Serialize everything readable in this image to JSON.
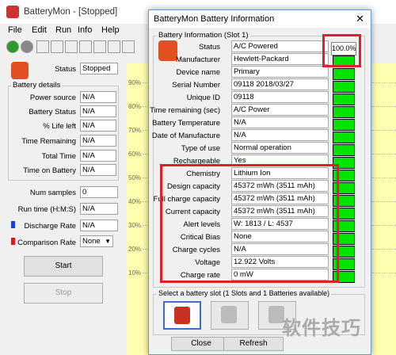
{
  "main": {
    "title": "BatteryMon - [Stopped]",
    "menu": [
      "File",
      "Edit",
      "Run",
      "Info",
      "Help"
    ],
    "status_label": "Status",
    "status_value": "Stopped",
    "details_title": "Battery details",
    "rows": [
      {
        "label": "Power source",
        "value": "N/A"
      },
      {
        "label": "Battery Status",
        "value": "N/A"
      },
      {
        "label": "% Life left",
        "value": "N/A"
      },
      {
        "label": "Time Remaining",
        "value": "N/A"
      },
      {
        "label": "Total Time",
        "value": "N/A"
      },
      {
        "label": "Time on Battery",
        "value": "N/A"
      }
    ],
    "num_samples_label": "Num samples",
    "num_samples": "0",
    "run_time_label": "Run time (H:M:S)",
    "run_time": "N/A",
    "discharge_label": "Discharge Rate",
    "discharge": "N/A",
    "comparison_label": "Comparison Rate",
    "comparison": "None",
    "start": "Start",
    "stop": "Stop",
    "graph_labels": [
      "90%",
      "80%",
      "70%",
      "60%",
      "50%",
      "40%",
      "30%",
      "20%",
      "10%"
    ]
  },
  "dialog": {
    "title": "BatteryMon Battery Information",
    "close": "✕",
    "group_title": "Battery Information (Slot 1)",
    "fields": [
      {
        "label": "Status",
        "value": "A/C Powered"
      },
      {
        "label": "Manufacturer",
        "value": "Hewlett-Packard"
      },
      {
        "label": "Device name",
        "value": "Primary"
      },
      {
        "label": "Serial Number",
        "value": "09118 2018/03/27"
      },
      {
        "label": "Unique ID",
        "value": "09118"
      },
      {
        "label": "Time remaining (sec)",
        "value": "A/C Power"
      },
      {
        "label": "Battery Temperature",
        "value": "N/A"
      },
      {
        "label": "Date of Manufacture",
        "value": "N/A"
      },
      {
        "label": "Type of use",
        "value": "Normal operation"
      },
      {
        "label": "Rechargeable",
        "value": "Yes"
      },
      {
        "label": "Chemistry",
        "value": "Lithium Ion"
      },
      {
        "label": "Design capacity",
        "value": "45372 mWh (3511 mAh)"
      },
      {
        "label": "Full charge capacity",
        "value": "45372 mWh (3511 mAh)"
      },
      {
        "label": "Current capacity",
        "value": "45372 mWh (3511 mAh)"
      },
      {
        "label": "Alert levels",
        "value": "W: 1813 / L: 4537"
      },
      {
        "label": "Critical Bias",
        "value": "None"
      },
      {
        "label": "Charge cycles",
        "value": "N/A"
      },
      {
        "label": "Voltage",
        "value": "12.922 Volts"
      },
      {
        "label": "Charge rate",
        "value": "0 mW"
      }
    ],
    "percent": "100.0%",
    "slot_group_title": "Select a battery slot (1 Slots and 1 Batteries available)",
    "close_btn": "Close",
    "refresh_btn": "Refresh"
  },
  "watermark": "软件技巧",
  "colors": {
    "highlight": "#e0202a",
    "bar": "#00e400",
    "graph_bg": "#ffffb0"
  }
}
